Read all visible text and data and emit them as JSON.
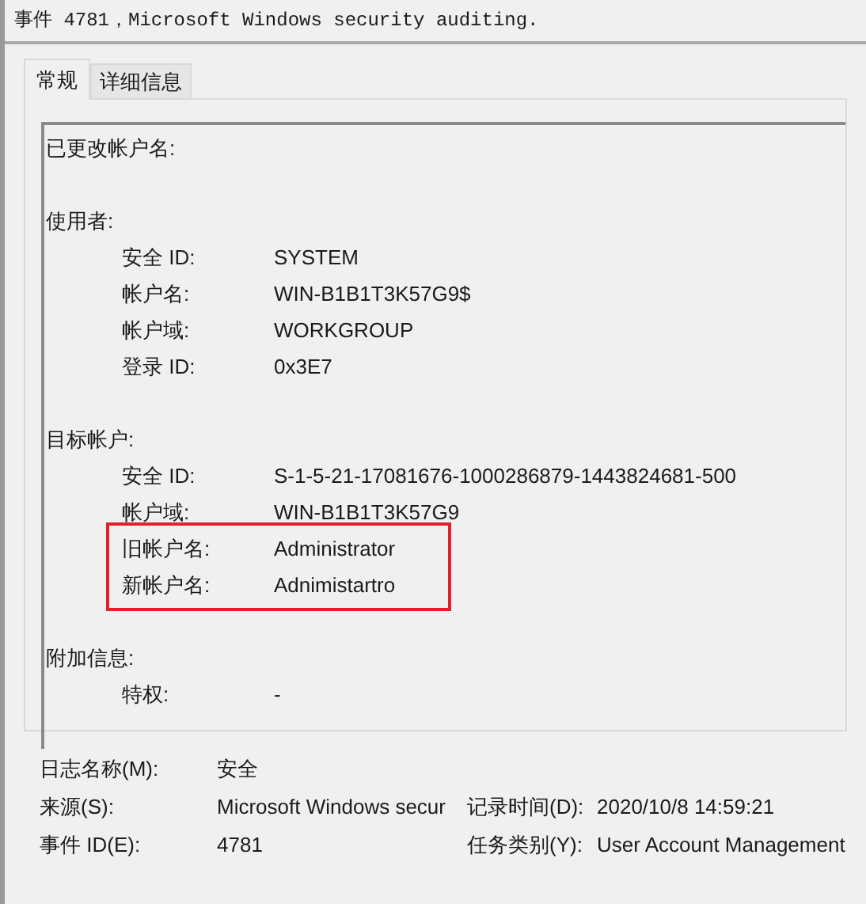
{
  "window": {
    "title": "事件 4781，Microsoft Windows security auditing."
  },
  "tabs": [
    {
      "label": "常规",
      "selected": true
    },
    {
      "label": "详细信息",
      "selected": false
    }
  ],
  "description": {
    "sections": [
      {
        "heading": "已更改帐户名:"
      },
      {
        "heading": "使用者:",
        "rows": [
          {
            "label": "安全 ID:",
            "value": "SYSTEM",
            "highlighted": false
          },
          {
            "label": "帐户名:",
            "value": "WIN-B1B1T3K57G9$",
            "highlighted": false
          },
          {
            "label": "帐户域:",
            "value": "WORKGROUP",
            "highlighted": false
          },
          {
            "label": "登录 ID:",
            "value": "0x3E7",
            "highlighted": false
          }
        ]
      },
      {
        "heading": "目标帐户:",
        "rows": [
          {
            "label": "安全 ID:",
            "value": "S-1-5-21-17081676-1000286879-1443824681-500",
            "highlighted": false
          },
          {
            "label": "帐户域:",
            "value": "WIN-B1B1T3K57G9",
            "highlighted": false
          },
          {
            "label": "旧帐户名:",
            "value": "Administrator",
            "highlighted": true
          },
          {
            "label": "新帐户名:",
            "value": "Adnimistartro",
            "highlighted": true
          }
        ]
      },
      {
        "heading": "附加信息:",
        "rows": [
          {
            "label": "特权:",
            "value": "-",
            "highlighted": false
          }
        ]
      }
    ]
  },
  "properties": [
    [
      {
        "label": "日志名称(M):",
        "value": "安全"
      }
    ],
    [
      {
        "label": "来源(S):",
        "value": "Microsoft Windows secur"
      },
      {
        "label": "记录时间(D):",
        "value": "2020/10/8 14:59:21"
      }
    ],
    [
      {
        "label": "事件 ID(E):",
        "value": "4781"
      },
      {
        "label": "任务类别(Y):",
        "value": "User Account Management"
      }
    ]
  ]
}
